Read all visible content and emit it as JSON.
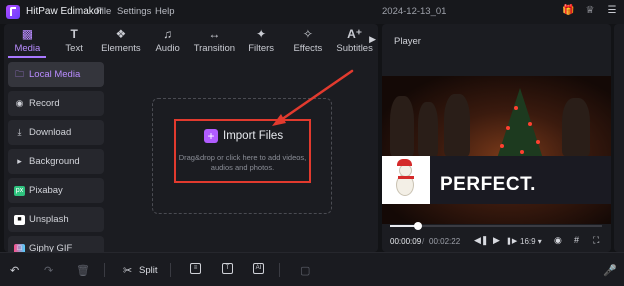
{
  "app": {
    "name": "HitPaw Edimakor",
    "menu": [
      "File",
      "Settings",
      "Help"
    ],
    "project_name": "2024-12-13_01",
    "title_icons": [
      "gift-icon",
      "crown-icon",
      "hamburger-menu-icon"
    ]
  },
  "tabs": [
    {
      "label": "Media",
      "icon": "media-icon",
      "active": true
    },
    {
      "label": "Text",
      "icon": "text-icon",
      "active": false
    },
    {
      "label": "Elements",
      "icon": "elements-icon",
      "active": false
    },
    {
      "label": "Audio",
      "icon": "audio-icon",
      "active": false
    },
    {
      "label": "Transition",
      "icon": "transition-icon",
      "active": false
    },
    {
      "label": "Filters",
      "icon": "filters-icon",
      "active": false
    },
    {
      "label": "Effects",
      "icon": "effects-icon",
      "active": false
    },
    {
      "label": "Subtitles",
      "icon": "subtitles-icon",
      "active": false
    }
  ],
  "sidebar": {
    "items": [
      {
        "label": "Local Media",
        "icon": "folder-icon",
        "active": true
      },
      {
        "label": "Record",
        "icon": "record-icon",
        "active": false
      },
      {
        "label": "Download",
        "icon": "download-icon",
        "active": false
      },
      {
        "label": "Background",
        "icon": "play-triangle-icon",
        "active": false
      },
      {
        "label": "Pixabay",
        "icon": "pixabay-icon",
        "active": false
      },
      {
        "label": "Unsplash",
        "icon": "unsplash-icon",
        "active": false
      },
      {
        "label": "Giphy GIF",
        "icon": "giphy-icon",
        "active": false
      }
    ]
  },
  "import": {
    "label": "Import Files",
    "hint": "Drag&drop or click here to add videos, audios and photos."
  },
  "player": {
    "title": "Player",
    "overlay_text": "PERFECT.",
    "current_time": "00:00:09",
    "separator": "/",
    "total_time": "00:02:22",
    "aspect_ratio": "16:9",
    "progress": 0.13
  },
  "bottombar": {
    "split_label": "Split"
  },
  "colors": {
    "accent": "#b98cff",
    "highlight_box": "#e23a2e",
    "background": "#121316",
    "panel": "#1b1c21"
  }
}
